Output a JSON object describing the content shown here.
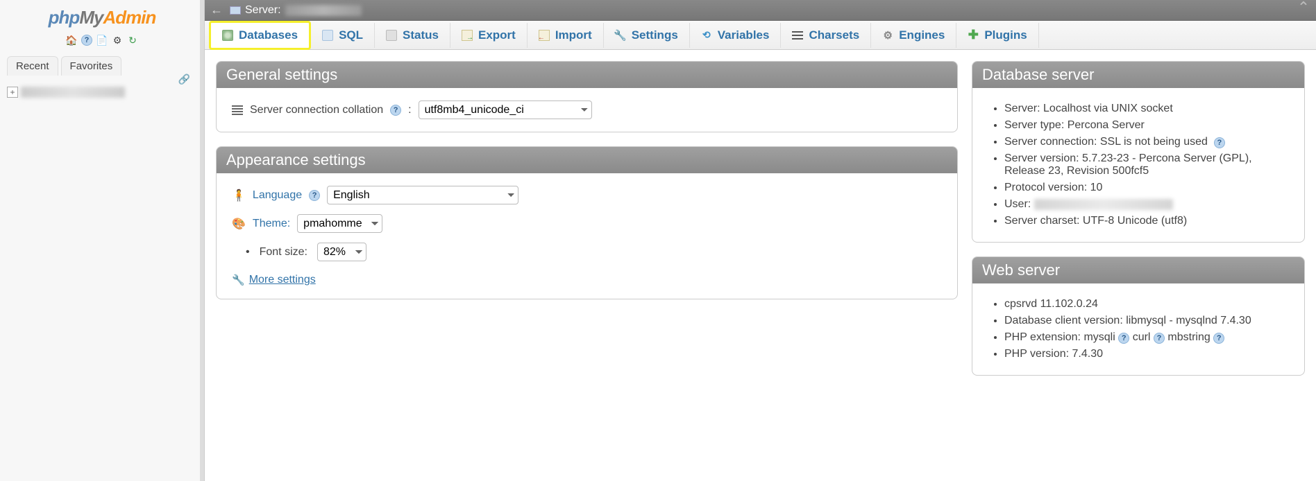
{
  "sidebar": {
    "logo": {
      "php": "php",
      "my": "My",
      "admin": "Admin"
    },
    "tabs": {
      "recent": "Recent",
      "favorites": "Favorites"
    }
  },
  "topbar": {
    "server_label": "Server:"
  },
  "menu": [
    {
      "label": "Databases"
    },
    {
      "label": "SQL"
    },
    {
      "label": "Status"
    },
    {
      "label": "Export"
    },
    {
      "label": "Import"
    },
    {
      "label": "Settings"
    },
    {
      "label": "Variables"
    },
    {
      "label": "Charsets"
    },
    {
      "label": "Engines"
    },
    {
      "label": "Plugins"
    }
  ],
  "general": {
    "title": "General settings",
    "collation_label": "Server connection collation",
    "collation_value": "utf8mb4_unicode_ci"
  },
  "appearance": {
    "title": "Appearance settings",
    "language_label": "Language",
    "language_value": "English",
    "theme_label": "Theme:",
    "theme_value": "pmahomme",
    "fontsize_label": "Font size:",
    "fontsize_value": "82%",
    "more": "More settings"
  },
  "dbserver": {
    "title": "Database server",
    "items": [
      "Server: Localhost via UNIX socket",
      "Server type: Percona Server",
      "Server connection: SSL is not being used",
      "Server version: 5.7.23-23 - Percona Server (GPL), Release 23, Revision 500fcf5",
      "Protocol version: 10",
      "User:",
      "Server charset: UTF-8 Unicode (utf8)"
    ]
  },
  "webserver": {
    "title": "Web server",
    "items": {
      "cpsrvd": "cpsrvd 11.102.0.24",
      "dbclient": "Database client version: libmysql - mysqlnd 7.4.30",
      "phpext_prefix": "PHP extension:",
      "phpext_1": "mysqli",
      "phpext_2": "curl",
      "phpext_3": "mbstring",
      "phpver": "PHP version: 7.4.30"
    }
  }
}
